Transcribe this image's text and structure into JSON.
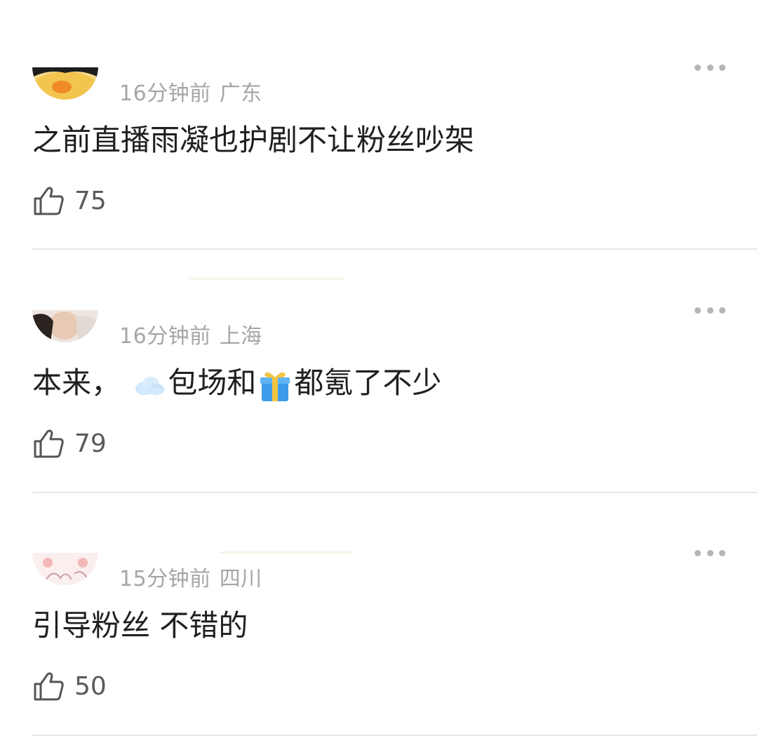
{
  "comments": [
    {
      "time": "16分钟前",
      "location": "广东",
      "text": "之前直播雨凝也护剧不让粉丝吵架",
      "likes": "75"
    },
    {
      "time": "16分钟前",
      "location": "上海",
      "text_parts": [
        "本来，",
        "包场和",
        "都氪了不少"
      ],
      "emojis": [
        "cloud-emoji",
        "gift-emoji"
      ],
      "likes": "79"
    },
    {
      "time": "15分钟前",
      "location": "四川",
      "text": "引导粉丝 不错的",
      "likes": "50"
    }
  ],
  "icons": {
    "more": "more-dots-icon",
    "like": "thumbs-up-icon"
  },
  "colors": {
    "meta": "#a6a6a6",
    "text": "#1f1f1f",
    "like_count": "#5a5a5a",
    "divider": "#e6e6e6"
  }
}
